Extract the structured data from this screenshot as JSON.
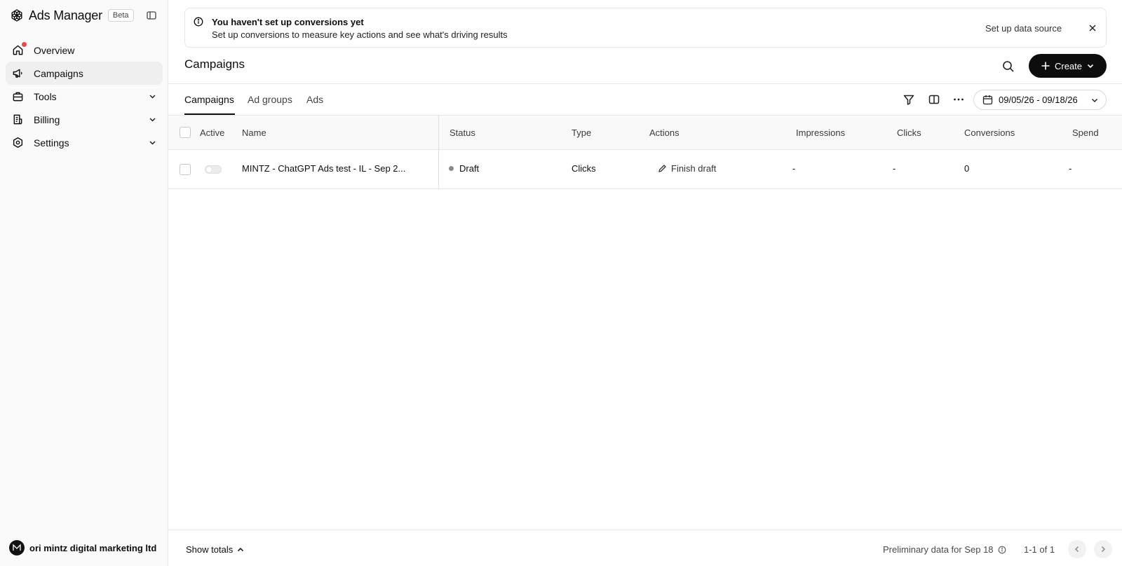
{
  "sidebar": {
    "brand_title": "Ads Manager",
    "beta_label": "Beta",
    "items": [
      {
        "label": "Overview"
      },
      {
        "label": "Campaigns"
      },
      {
        "label": "Tools"
      },
      {
        "label": "Billing"
      },
      {
        "label": "Settings"
      }
    ],
    "account_name": "ori mintz digital marketing ltd"
  },
  "banner": {
    "title": "You haven't set up conversions yet",
    "text": "Set up conversions to measure key actions and see what's driving results",
    "link": "Set up data source"
  },
  "header": {
    "title": "Campaigns",
    "create_label": "Create"
  },
  "tabs": [
    {
      "label": "Campaigns",
      "active": true
    },
    {
      "label": "Ad groups",
      "active": false
    },
    {
      "label": "Ads",
      "active": false
    }
  ],
  "toolbar": {
    "date_range": "09/05/26 - 09/18/26"
  },
  "table": {
    "columns": [
      "Active",
      "Name",
      "Status",
      "Type",
      "Actions",
      "Impressions",
      "Clicks",
      "Conversions",
      "Spend"
    ],
    "rows": [
      {
        "name": "MINTZ - ChatGPT Ads test - IL - Sep 2...",
        "status": "Draft",
        "type": "Clicks",
        "action": "Finish draft",
        "impressions": "-",
        "clicks": "-",
        "conversions": "0",
        "spend": "-"
      }
    ]
  },
  "footer": {
    "show_totals": "Show totals",
    "preliminary": "Preliminary data for Sep 18",
    "page_count": "1-1 of 1"
  },
  "colors": {
    "accent": "#0d0d0d",
    "notification": "#e5484d",
    "draft_dot": "#8a8a8a"
  }
}
